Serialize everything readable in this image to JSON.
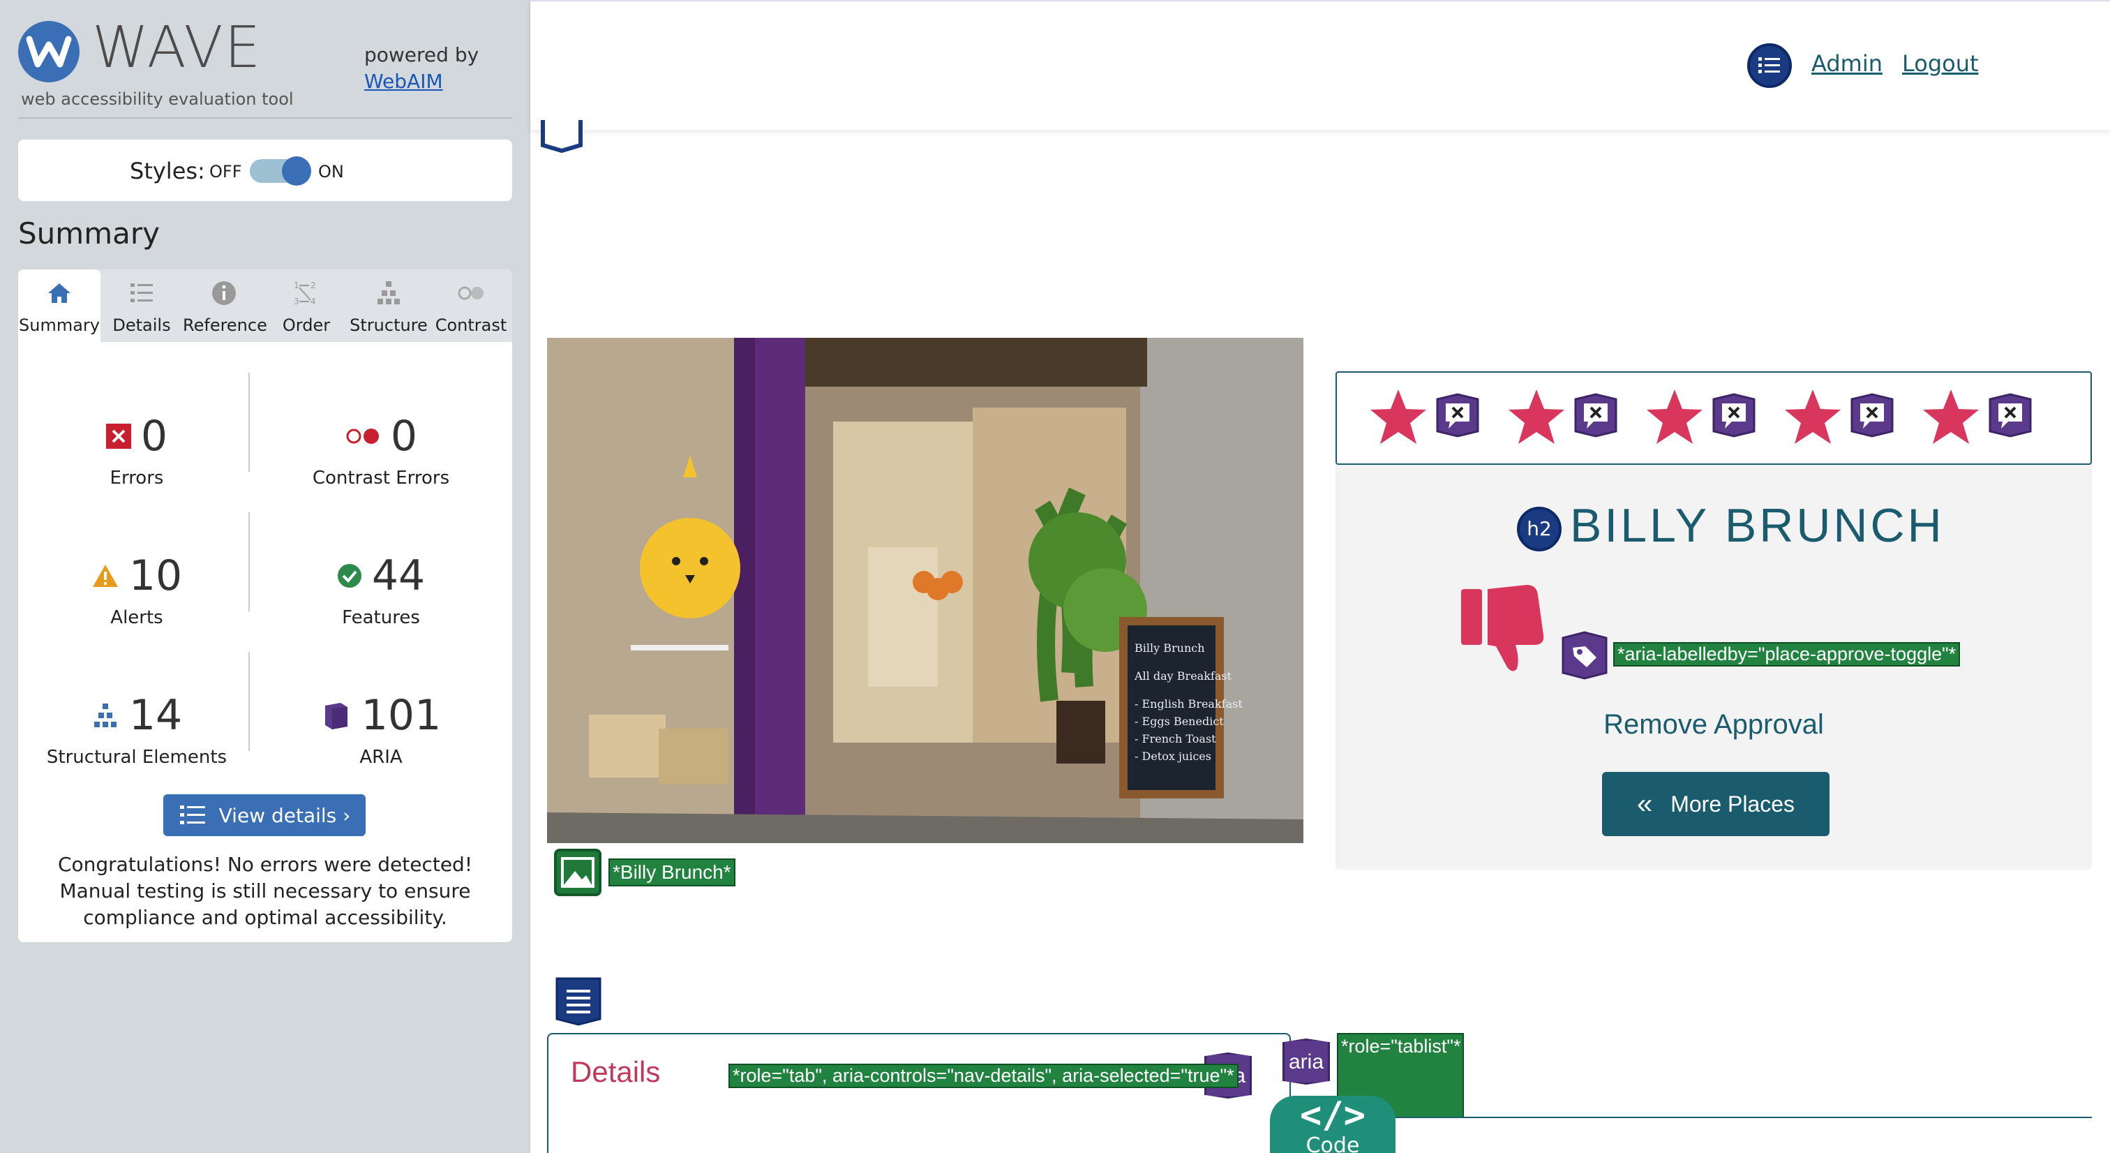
{
  "wave": {
    "brand": "WAVE",
    "tagline": "web accessibility evaluation tool",
    "powered_by": "powered by",
    "powered_link": "WebAIM",
    "styles_label": "Styles:",
    "styles_off": "OFF",
    "styles_on": "ON",
    "styles_enabled": true,
    "summary_heading": "Summary",
    "tabs": [
      {
        "label": "Summary",
        "icon": "home-icon",
        "active": true
      },
      {
        "label": "Details",
        "icon": "list-icon",
        "active": false
      },
      {
        "label": "Reference",
        "icon": "info-icon",
        "active": false
      },
      {
        "label": "Order",
        "icon": "order-icon",
        "active": false
      },
      {
        "label": "Structure",
        "icon": "structure-icon",
        "active": false
      },
      {
        "label": "Contrast",
        "icon": "contrast-icon",
        "active": false
      }
    ],
    "stats": {
      "errors": {
        "count": "0",
        "label": "Errors"
      },
      "contrast_errors": {
        "count": "0",
        "label": "Contrast Errors"
      },
      "alerts": {
        "count": "10",
        "label": "Alerts"
      },
      "features": {
        "count": "44",
        "label": "Features"
      },
      "structural": {
        "count": "14",
        "label": "Structural Elements"
      },
      "aria": {
        "count": "101",
        "label": "ARIA"
      }
    },
    "view_details": "View details ›",
    "congrats": "Congratulations! No errors were detected! Manual testing is still necessary to ensure compliance and optimal accessibility."
  },
  "site": {
    "nav": {
      "admin": "Admin",
      "logout": "Logout"
    },
    "photo_alt_label": "*Billy Brunch*",
    "rating_stars": 5,
    "h2_badge": "h2",
    "place_title": "BILLY BRUNCH",
    "aria_labelledby": "*aria-labelledby=\"place-approve-toggle\"*",
    "remove_approval": "Remove Approval",
    "more_places": "More Places",
    "details_tab": "Details",
    "aria_badge": "aria",
    "tab_aria": "*role=\"tab\", aria-controls=\"nav-details\", aria-selected=\"true\"*",
    "tablist_aria": "*role=\"tablist\"*",
    "code_toggle": "Code",
    "code_glyph": "</>"
  },
  "colors": {
    "wave_blue": "#3a6fb6",
    "teal": "#1a5b6e",
    "star_pink": "#d8365c",
    "aria_purple": "#5b3a8c",
    "feature_green": "#228240"
  }
}
